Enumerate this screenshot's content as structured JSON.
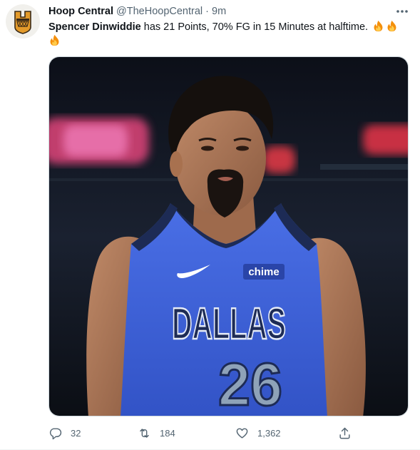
{
  "tweet": {
    "display_name": "Hoop Central",
    "handle": "@TheHoopCentral",
    "separator": "·",
    "time": "9m",
    "text_bold": "Spencer Dinwiddie",
    "text_rest": " has 21 Points, 70% FG in 15 Minutes at halftime. ",
    "emoji": [
      "fire",
      "fire",
      "fire"
    ]
  },
  "photo": {
    "jersey_city": "DALLAS",
    "jersey_number": "26",
    "sponsor_patch": "chime",
    "jersey_color": "#3f62d8",
    "trim_color": "#1d2b55"
  },
  "actions": {
    "replies": "32",
    "retweets": "184",
    "likes": "1,362"
  },
  "colors": {
    "text_primary": "#0f1419",
    "text_secondary": "#536471",
    "border": "#cfd9de"
  }
}
